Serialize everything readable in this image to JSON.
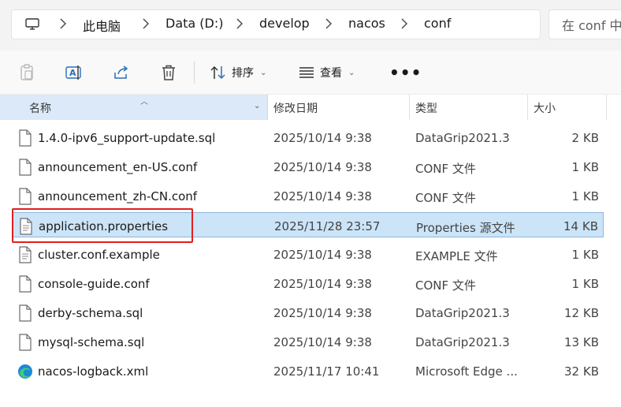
{
  "breadcrumb": {
    "items": [
      "此电脑",
      "Data (D:)",
      "develop",
      "nacos",
      "conf"
    ]
  },
  "search": {
    "placeholder": "在 conf 中"
  },
  "toolbar": {
    "sort_label": "排序",
    "view_label": "查看",
    "more_label": "•••"
  },
  "columns": {
    "name": "名称",
    "date": "修改日期",
    "type": "类型",
    "size": "大小"
  },
  "files": [
    {
      "name": "1.4.0-ipv6_support-update.sql",
      "date": "2025/10/14 9:38",
      "type": "DataGrip2021.3",
      "size": "2 KB",
      "icon": "file-icon"
    },
    {
      "name": "announcement_en-US.conf",
      "date": "2025/10/14 9:38",
      "type": "CONF 文件",
      "size": "1 KB",
      "icon": "file-icon"
    },
    {
      "name": "announcement_zh-CN.conf",
      "date": "2025/10/14 9:38",
      "type": "CONF 文件",
      "size": "1 KB",
      "icon": "file-icon"
    },
    {
      "name": "application.properties",
      "date": "2025/11/28 23:57",
      "type": "Properties 源文件",
      "size": "14 KB",
      "icon": "text-file-icon",
      "selected": true
    },
    {
      "name": "cluster.conf.example",
      "date": "2025/10/14 9:38",
      "type": "EXAMPLE 文件",
      "size": "1 KB",
      "icon": "text-file-icon"
    },
    {
      "name": "console-guide.conf",
      "date": "2025/10/14 9:38",
      "type": "CONF 文件",
      "size": "1 KB",
      "icon": "file-icon"
    },
    {
      "name": "derby-schema.sql",
      "date": "2025/10/14 9:38",
      "type": "DataGrip2021.3",
      "size": "12 KB",
      "icon": "file-icon"
    },
    {
      "name": "mysql-schema.sql",
      "date": "2025/10/14 9:38",
      "type": "DataGrip2021.3",
      "size": "13 KB",
      "icon": "file-icon"
    },
    {
      "name": "nacos-logback.xml",
      "date": "2025/11/17 10:41",
      "type": "Microsoft Edge ...",
      "size": "32 KB",
      "icon": "edge-icon"
    }
  ]
}
